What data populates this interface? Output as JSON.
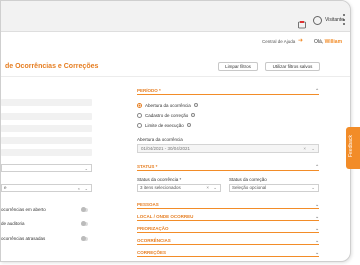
{
  "browser": {
    "profile_label": "Visitante"
  },
  "header": {
    "help_label": "Central de Ajuda",
    "greeting": "Olá,",
    "user_name": "William"
  },
  "page": {
    "title": "de Ocorrências e Correções",
    "clear_filters_label": "Limpar filtros",
    "saved_filters_label": "Utilizar filtros salvos"
  },
  "left_panel": {
    "select_value": "e",
    "toggles": [
      {
        "label": "ocorrências em aberto"
      },
      {
        "label": "de auditoria"
      },
      {
        "label": "ocorrências atrasadas"
      }
    ]
  },
  "period": {
    "heading": "PERÍODO *",
    "options": [
      {
        "label": "Abertura da ocorrência",
        "selected": true
      },
      {
        "label": "Cadastro de correção",
        "selected": false
      },
      {
        "label": "Limite de execução",
        "selected": false
      }
    ],
    "date_label": "Abertura da ocorrência",
    "date_value": "01/04/2021 - 30/04/2021"
  },
  "status": {
    "heading": "STATUS *",
    "occurrence_label": "Status da ocorrência *",
    "occurrence_value": "3 itens selecionados",
    "correction_label": "Status da correção",
    "correction_placeholder": "Seleção opcional"
  },
  "sections": [
    "PESSOAS",
    "LOCAL / ONDE OCORREU",
    "PRIORIZAÇÃO",
    "OCORRÊNCIAS",
    "CORREÇÕES"
  ],
  "feedback": {
    "label": "Feedback"
  },
  "colors": {
    "accent": "#f28c28",
    "accent_text": "#e67e22"
  }
}
